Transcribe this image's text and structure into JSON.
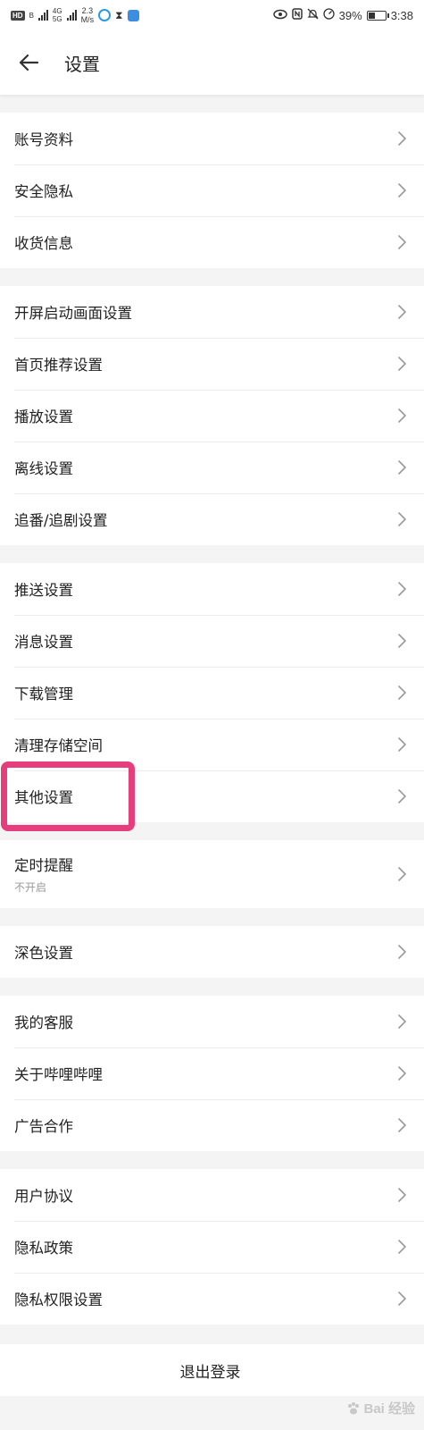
{
  "status_bar": {
    "hd": "HD",
    "hd_sub": "B",
    "net_4g_top": "4G",
    "net_4g_bottom": "5G",
    "speed_top": "2.3",
    "speed_bottom": "M/s",
    "battery": "39%",
    "time": "3:38",
    "battery_level": 0.39
  },
  "header": {
    "title": "设置"
  },
  "groups": [
    {
      "items": [
        {
          "label": "账号资料"
        },
        {
          "label": "安全隐私"
        },
        {
          "label": "收货信息"
        }
      ]
    },
    {
      "items": [
        {
          "label": "开屏启动画面设置"
        },
        {
          "label": "首页推荐设置"
        },
        {
          "label": "播放设置"
        },
        {
          "label": "离线设置"
        },
        {
          "label": "追番/追剧设置"
        }
      ]
    },
    {
      "items": [
        {
          "label": "推送设置"
        },
        {
          "label": "消息设置"
        },
        {
          "label": "下载管理"
        },
        {
          "label": "清理存储空间"
        },
        {
          "label": "其他设置"
        }
      ]
    },
    {
      "items": [
        {
          "label": "定时提醒",
          "sub": "不开启"
        }
      ]
    },
    {
      "items": [
        {
          "label": "深色设置"
        }
      ]
    },
    {
      "items": [
        {
          "label": "我的客服"
        },
        {
          "label": "关于哔哩哔哩"
        },
        {
          "label": "广告合作"
        }
      ]
    },
    {
      "items": [
        {
          "label": "用户协议"
        },
        {
          "label": "隐私政策"
        },
        {
          "label": "隐私权限设置"
        }
      ]
    }
  ],
  "logout": {
    "label": "退出登录"
  },
  "watermark": {
    "text": "Bai 经验"
  },
  "colors": {
    "highlight": "#e63e7c",
    "background": "#f4f4f4"
  }
}
